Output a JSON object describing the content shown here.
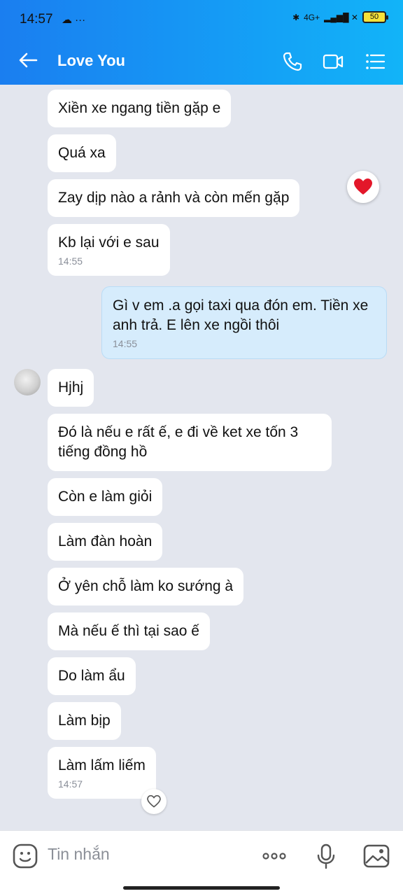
{
  "status_bar": {
    "time": "14:57",
    "battery": "50",
    "network": "4G+"
  },
  "header": {
    "title": "Love You"
  },
  "messages": [
    {
      "text": "Xiền xe ngang tiền gặp e"
    },
    {
      "text": "Quá xa"
    },
    {
      "text": "Zay dịp nào a rảnh và còn mến gặp"
    },
    {
      "text": "Kb lại với e sau",
      "time": "14:55"
    },
    {
      "text": "Gì v em .a gọi taxi qua đón em. Tiền xe anh trả. E lên xe ngồi thôi",
      "time": "14:55",
      "sender": "me"
    },
    {
      "text": "Hjhj"
    },
    {
      "text": "Đó là nếu e rất ế, e đi về ket xe tốn 3 tiếng đồng hồ"
    },
    {
      "text": "Còn e làm giỏi"
    },
    {
      "text": "Làm đàn hoàn"
    },
    {
      "text": "Ở yên chỗ làm ko sướng à"
    },
    {
      "text": "Mà nếu ế thì tại sao ế"
    },
    {
      "text": "Do làm ẩu"
    },
    {
      "text": "Làm bịp"
    },
    {
      "text": "Làm lấm liếm",
      "time": "14:57"
    }
  ],
  "composer": {
    "placeholder": "Tin nhắn"
  },
  "colors": {
    "header_start": "#1a7ef0",
    "header_end": "#12b4f8",
    "sent_bubble": "#d6ecfc",
    "received_bubble": "#ffffff",
    "background": "#e3e6ee"
  },
  "icons": [
    "back-arrow-icon",
    "phone-icon",
    "video-call-icon",
    "menu-icon",
    "heart-reaction-icon",
    "heart-outline-icon",
    "emoji-icon",
    "more-icon",
    "microphone-icon",
    "image-icon"
  ]
}
